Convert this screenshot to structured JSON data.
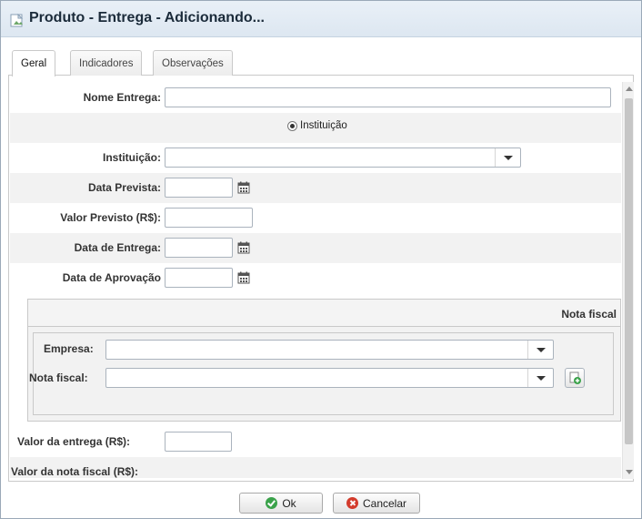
{
  "window": {
    "title": "Produto - Entrega - Adicionando..."
  },
  "tabs": [
    {
      "label": "Geral",
      "active": true
    },
    {
      "label": "Indicadores",
      "active": false
    },
    {
      "label": "Observações",
      "active": false
    }
  ],
  "form": {
    "nome_entrega_label": "Nome Entrega:",
    "nome_entrega_value": "",
    "radio_instituicao_label": "Instituição",
    "instituicao_label": "Instituição:",
    "instituicao_value": "",
    "data_prevista_label": "Data Prevista:",
    "valor_previsto_label": "Valor Previsto (R$):",
    "data_entrega_label": "Data de Entrega:",
    "data_aprovacao_label": "Data de Aprovação",
    "valor_entrega_label": "Valor da entrega (R$):",
    "valor_nota_fiscal_label": "Valor da nota fiscal (R$):"
  },
  "nota_fiscal_section": {
    "title": "Nota fiscal",
    "empresa_label": "Empresa:",
    "nota_fiscal_label": "Nota fiscal:"
  },
  "footer": {
    "ok_label": "Ok",
    "cancel_label": "Cancelar"
  },
  "colors": {
    "titlebar": "#e3ebf4",
    "ok_icon": "#3aa24a",
    "cancel_icon": "#d33b2c"
  }
}
